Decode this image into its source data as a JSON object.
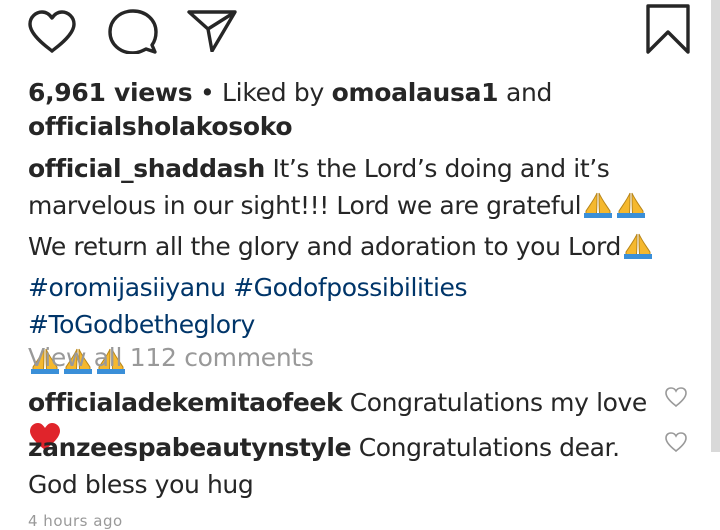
{
  "stats": {
    "views": "6,961 views",
    "separator": "•",
    "liked_by_prefix": "Liked by",
    "liker1": "omoalausa1",
    "and": "and",
    "liker2": "officialsholakosoko"
  },
  "caption": {
    "username": "official_shaddash",
    "line1": "It’s the Lord’s doing and it’s marvelous in our sight!!! Lord we are grateful",
    "line2": "We return all the glory and adoration to you Lord",
    "hashtags": "#oromijasiiyanu #Godofpossibilities #ToGodbetheglory"
  },
  "view_all_comments": "View all 112 comments",
  "comments": [
    {
      "username": "officialadekemitaofeek",
      "text": "Congratulations my love"
    },
    {
      "username": "zanzeespabeautynstyle",
      "text": "Congratulations dear. God bless you hug"
    }
  ],
  "timestamp": "4 hours ago",
  "icons": {
    "like": "heart-outline-icon",
    "comment": "comment-bubble-icon",
    "share": "paper-plane-icon",
    "save": "bookmark-icon",
    "pray": "folded-hands-emoji",
    "red_heart": "red-heart-emoji"
  },
  "colors": {
    "text": "#262626",
    "hashtag": "#003569",
    "muted": "#999999",
    "heart": "#e0242b"
  }
}
